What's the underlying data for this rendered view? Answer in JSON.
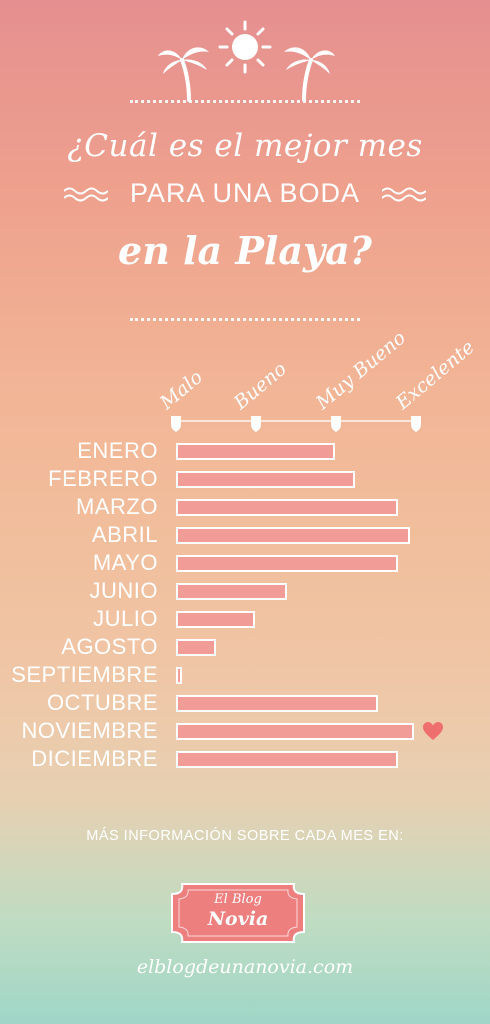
{
  "colors": {
    "bar_fill": "#f19c97",
    "bar_stroke": "#ffffff",
    "heart": "#ef6f6f",
    "text": "#ffffff"
  },
  "header": {
    "icons": [
      "palm-tree-icon",
      "sun-icon",
      "palm-tree-icon"
    ],
    "title_line1": "¿Cuál es el mejor mes",
    "title_line2": "PARA UNA BODA",
    "title_line3": "en la Playa?"
  },
  "chart_data": {
    "type": "bar",
    "orientation": "horizontal",
    "scale_labels": [
      "Malo",
      "Bueno",
      "Muy Bueno",
      "Excelente"
    ],
    "xlim": [
      0,
      3
    ],
    "categories": [
      "ENERO",
      "FEBRERO",
      "MARZO",
      "ABRIL",
      "MAYO",
      "JUNIO",
      "JULIO",
      "AGOSTO",
      "SEPTIEMBRE",
      "OCTUBRE",
      "NOVIEMBRE",
      "DICIEMBRE"
    ],
    "values": [
      2.0,
      2.25,
      2.8,
      2.95,
      2.8,
      1.4,
      1.0,
      0.5,
      0.08,
      2.55,
      3.0,
      2.8
    ],
    "highlight": {
      "category": "NOVIEMBRE",
      "icon": "heart-icon"
    }
  },
  "footer": {
    "more_info": "MÁS INFORMACIÓN SOBRE CADA MES EN:",
    "logo_line1": "El Blog",
    "logo_line2": "Novia",
    "website": "elblogdeunanovia.com"
  }
}
